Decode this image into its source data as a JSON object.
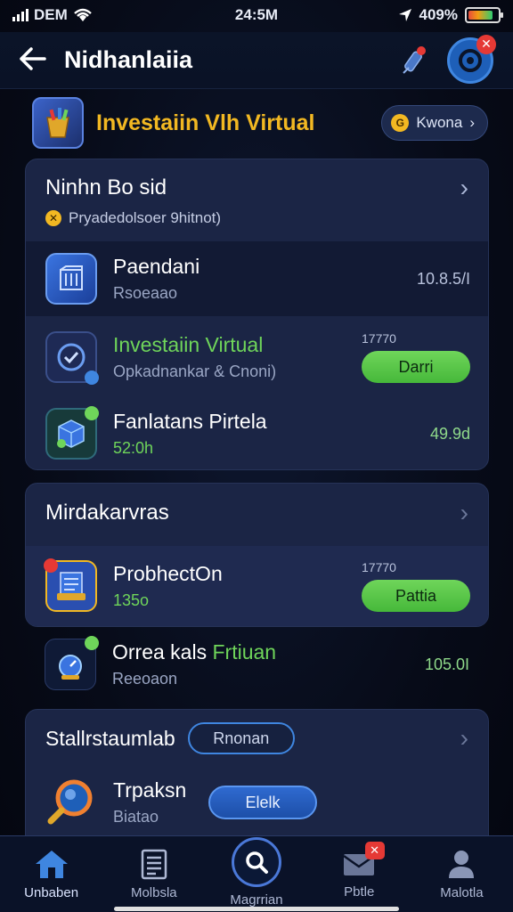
{
  "status_bar": {
    "carrier": "DEM",
    "time": "24:5M",
    "battery_text": "409%",
    "battery_level": 0.85
  },
  "header": {
    "title": "Nidhanlaiia"
  },
  "banner": {
    "title": "Investaiin Vlh Virtual",
    "pill_label": "Kwona",
    "pill_chevron": "›",
    "coin_symbol": "G"
  },
  "section1": {
    "title": "Ninhn Bo sid",
    "subtitle": "Pryadedolsoer 9hitnot)",
    "rows": [
      {
        "title": "Paendani",
        "sub": "Rsoeaao",
        "value": "10.8.5/I"
      },
      {
        "title": "Investaiin Virtual",
        "sub": "Opkadnankar & Cnoni)",
        "small": "17770",
        "button": "Darri"
      },
      {
        "title": "Fanlatans Pirtela",
        "sub": "52:0h",
        "value": "49.9d"
      }
    ]
  },
  "section2": {
    "title": "Mirdakarvras",
    "rows": [
      {
        "title": "ProbhectOn",
        "sub": "135o",
        "small": "17770",
        "button": "Pattia"
      },
      {
        "title_part1": "Orrea kals ",
        "title_part2": "Frtiuan",
        "sub": "Reeoaon",
        "value": "105.0I"
      }
    ]
  },
  "section3": {
    "title": "Stallrstaumlab",
    "title_button": "Rnonan",
    "rows": [
      {
        "title": "Trpaksn",
        "sub": "Biatao",
        "button": "Elelk"
      }
    ]
  },
  "bottom_nav": [
    {
      "label": "Unbaben",
      "icon": "home-icon"
    },
    {
      "label": "Molbsla",
      "icon": "document-icon"
    },
    {
      "label": "Magrrian",
      "icon": "search-icon"
    },
    {
      "label": "Pbtle",
      "icon": "mail-icon",
      "badge": "✕"
    },
    {
      "label": "Malotla",
      "icon": "profile-icon"
    }
  ],
  "colors": {
    "accent_gold": "#f2b822",
    "accent_green": "#6fd55a",
    "accent_blue": "#3f86e0",
    "badge_red": "#e53935"
  }
}
